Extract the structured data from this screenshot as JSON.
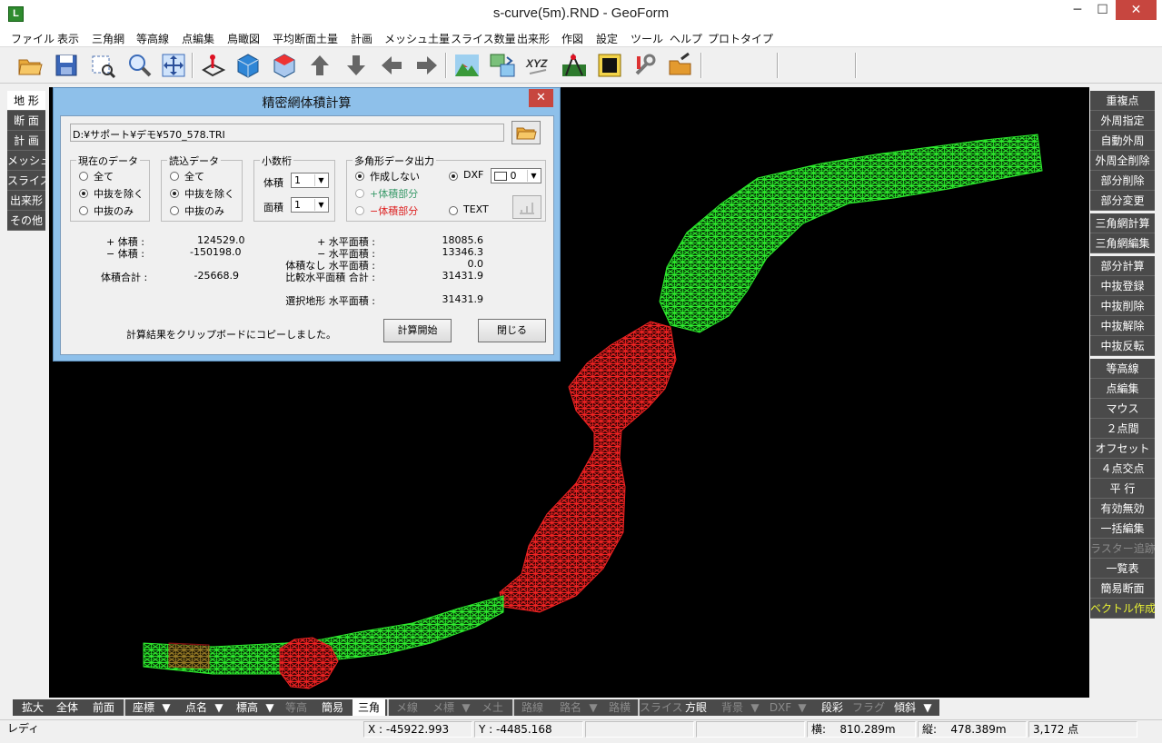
{
  "window": {
    "title": "s-curve(5m).RND - GeoForm",
    "app_icon_letter": "L",
    "min": "─",
    "max": "☐",
    "close": "✕"
  },
  "menu": [
    "ファイル",
    "表示",
    "三角網",
    "等高線",
    "点編集",
    "鳥瞰図",
    "平均断面土量",
    "計画",
    "メッシュ土量",
    "スライス数量",
    "出来形",
    "作図",
    "設定",
    "ツール",
    "ヘルプ",
    "プロトタイプ"
  ],
  "left_tabs": [
    "地 形",
    "断 面",
    "計 画",
    "メッシュ",
    "スライス",
    "出来形",
    "その他"
  ],
  "right_buttons": [
    "重複点",
    "外周指定",
    "自動外周",
    "外周全削除",
    "部分削除",
    "部分変更",
    "三角網計算",
    "三角網編集",
    "部分計算",
    "中抜登録",
    "中抜削除",
    "中抜解除",
    "中抜反転",
    "等高線",
    "点編集",
    "マウス",
    "２点間",
    "オフセット",
    "４点交点",
    "平 行",
    "有効無効",
    "一括編集",
    "ラスター追跡",
    "一覧表",
    "簡易断面",
    "ベクトル作成"
  ],
  "bottom_bar": [
    "拡大",
    "全体",
    "前面",
    "座標",
    "▼",
    "点名",
    "▼",
    "標高",
    "▼",
    "等高",
    "簡易",
    "三角",
    "メ線",
    "メ標",
    "▼",
    "メ土",
    "路線",
    "路名",
    "▼",
    "路横",
    "スライス",
    "方眼",
    "背景",
    "▼",
    "DXF",
    "▼",
    "段彩",
    "フラグ",
    "傾斜",
    "▼"
  ],
  "status": {
    "ready": "レディ",
    "x": "X : -45922.993",
    "y": "Y :  -4485.168",
    "width_label": "横:",
    "width_val": "810.289m",
    "height_label": "縦:",
    "height_val": "478.389m",
    "count": "3,172 点"
  },
  "dialog": {
    "title": "精密網体積計算",
    "close": "✕",
    "path": "D:¥サポート¥デモ¥570_578.TRI",
    "groups": {
      "current": {
        "label": "現在のデータ",
        "options": [
          "全て",
          "中抜を除く",
          "中抜のみ"
        ],
        "selected": 1
      },
      "loaded": {
        "label": "読込データ",
        "options": [
          "全て",
          "中抜を除く",
          "中抜のみ"
        ],
        "selected": 1
      },
      "decimals": {
        "label": "小数桁",
        "volume_label": "体積",
        "volume_val": "1",
        "area_label": "面積",
        "area_val": "1"
      },
      "polygon": {
        "label": "多角形データ出力",
        "opt_none": "作成しない",
        "opt_plus": "+体積部分",
        "opt_minus": "−体積部分",
        "opt_dxf": "DXF",
        "opt_text": "TEXT",
        "dxf_color": "0"
      }
    },
    "results": {
      "plus_vol_label": "+ 体積 :",
      "plus_vol": "124529.0",
      "minus_vol_label": "− 体積 :",
      "minus_vol": "-150198.0",
      "total_vol_label": "体積合計 :",
      "total_vol": "-25668.9",
      "plus_area_label": "+ 水平面積 :",
      "plus_area": "18085.6",
      "minus_area_label": "− 水平面積 :",
      "minus_area": "13346.3",
      "none_area_label": "体積なし 水平面積 :",
      "none_area": "0.0",
      "cmp_area_label": "比較水平面積 合計 :",
      "cmp_area": "31431.9",
      "sel_area_label": "選択地形 水平面積 :",
      "sel_area": "31431.9"
    },
    "message": "計算結果をクリップボードにコピーしました。",
    "calc_button": "計算開始",
    "close_button": "閉じる"
  },
  "colors": {
    "fill_plus": "#22dd22",
    "fill_minus": "#dd1a1a",
    "canvas": "#000000"
  }
}
